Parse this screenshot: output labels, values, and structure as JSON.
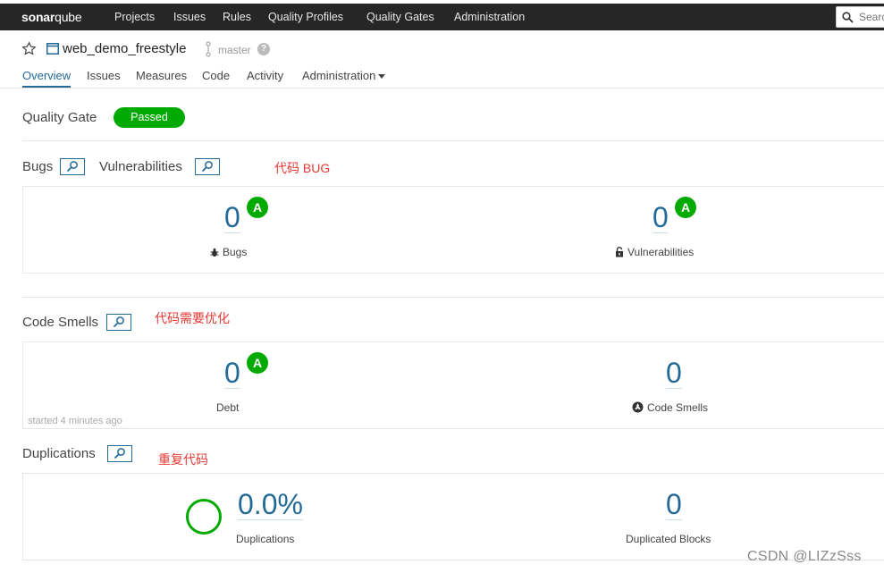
{
  "nav": {
    "logo_bold": "sonar",
    "logo_light": "qube",
    "items": [
      "Projects",
      "Issues",
      "Rules",
      "Quality Profiles",
      "Quality Gates",
      "Administration"
    ],
    "search_placeholder": "Searc"
  },
  "project": {
    "name": "web_demo_freestyle",
    "branch": "master",
    "help": "?",
    "tabs": [
      "Overview",
      "Issues",
      "Measures",
      "Code",
      "Activity",
      "Administration"
    ]
  },
  "quality_gate": {
    "label": "Quality Gate",
    "status": "Passed",
    "status_color": "#00aa00"
  },
  "sections": {
    "bugs_title": "Bugs",
    "vuln_title": "Vulnerabilities",
    "bugs_annotation": "代码 BUG",
    "smells_title": "Code Smells",
    "smells_annotation": "代码需要优化",
    "dup_title": "Duplications",
    "dup_annotation": "重复代码"
  },
  "metrics": {
    "bugs": {
      "value": "0",
      "rating": "A",
      "label": "Bugs"
    },
    "vulnerabilities": {
      "value": "0",
      "rating": "A",
      "label": "Vulnerabilities"
    },
    "debt": {
      "value": "0",
      "rating": "A",
      "label": "Debt"
    },
    "code_smells": {
      "value": "0",
      "label": "Code Smells"
    },
    "started": "started 4 minutes ago",
    "duplications": {
      "value": "0.0%",
      "label": "Duplications"
    },
    "duplicated_blocks": {
      "value": "0",
      "label": "Duplicated Blocks"
    }
  },
  "colors": {
    "accent": "#236a97",
    "rating_a": "#00aa00",
    "annotation": "#e53935"
  },
  "watermark": "CSDN @LIZzSss"
}
